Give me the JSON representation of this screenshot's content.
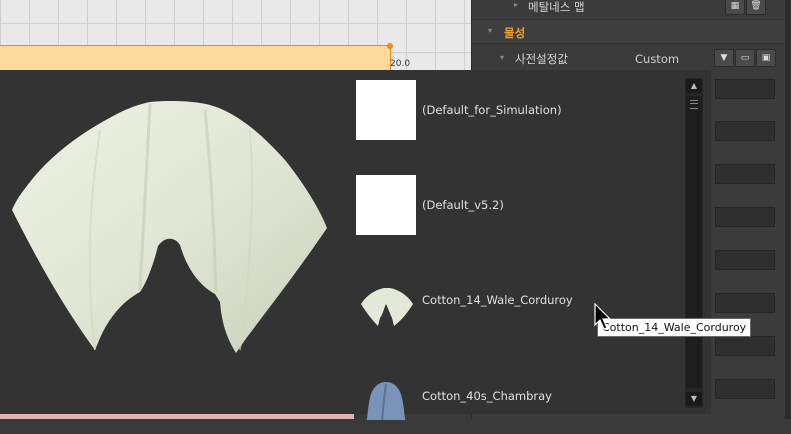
{
  "graph": {
    "value_label": "20.0"
  },
  "right_panel": {
    "metalness_map_label": "메탈네스 맵",
    "section_label": "물성",
    "preset_label": "사전설정값",
    "preset_value": "Custom"
  },
  "material_list": {
    "items": [
      {
        "name": "(Default_for_Simulation)",
        "thumb": "white"
      },
      {
        "name": "(Default_v5.2)",
        "thumb": "white"
      },
      {
        "name": "Cotton_14_Wale_Corduroy",
        "thumb": "fabric-cream"
      },
      {
        "name": "Cotton_40s_Chambray",
        "thumb": "fabric-blue"
      }
    ],
    "hovered": "Cotton_14_Wale_Corduroy"
  },
  "tooltip": {
    "text": "Cotton_14_Wale_Corduroy"
  },
  "icons": {
    "dropdown": "triangle-down-icon",
    "folder": "folder-icon",
    "save": "save-icon",
    "grid": "grid-icon",
    "trash": "trash-icon"
  },
  "colors": {
    "accent": "#f0a030",
    "graph_fill": "#fbd99a",
    "graph_line": "#f08a1c",
    "popup_bg": "#333333",
    "fabric_cream": "#e3e8d8",
    "fabric_blue": "#7a93b8"
  }
}
